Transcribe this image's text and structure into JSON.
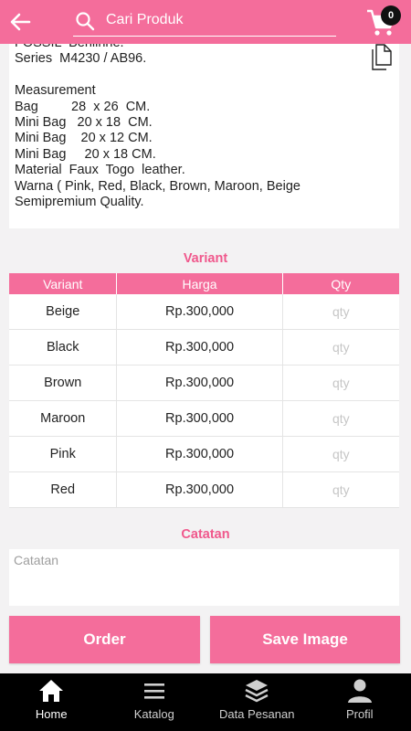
{
  "header": {
    "search_placeholder": "Cari Produk",
    "cart_count": "0"
  },
  "description": {
    "text": "FOSSIL  Benlinne.\nSeries  M4230 / AB96.\n\nMeasurement\nBag         28  x 26  CM.\nMini Bag   20 x 18  CM.\nMini Bag    20 x 12 CM.\nMini Bag     20 x 18 CM.\nMaterial  Faux  Togo  leather.\nWarna ( Pink, Red, Black, Brown, Maroon, Beige\nSemipremium Quality."
  },
  "variant_section": {
    "title": "Variant",
    "headers": [
      "Variant",
      "Harga",
      "Qty"
    ],
    "qty_placeholder": "qty",
    "rows": [
      {
        "variant": "Beige",
        "price": "Rp.300,000"
      },
      {
        "variant": "Black",
        "price": "Rp.300,000"
      },
      {
        "variant": "Brown",
        "price": "Rp.300,000"
      },
      {
        "variant": "Maroon",
        "price": "Rp.300,000"
      },
      {
        "variant": "Pink",
        "price": "Rp.300,000"
      },
      {
        "variant": "Red",
        "price": "Rp.300,000"
      }
    ]
  },
  "notes_section": {
    "title": "Catatan",
    "placeholder": "Catatan"
  },
  "actions": {
    "order_label": "Order",
    "save_label": "Save Image"
  },
  "nav": [
    {
      "label": "Home",
      "icon": "home-icon",
      "active": true
    },
    {
      "label": "Katalog",
      "icon": "menu-icon",
      "active": false
    },
    {
      "label": "Data Pesanan",
      "icon": "layers-icon",
      "active": false
    },
    {
      "label": "Profil",
      "icon": "user-icon",
      "active": false
    }
  ],
  "colors": {
    "accent": "#f46d9b",
    "accent_text": "#f0588c",
    "nav_bg": "#000000"
  }
}
